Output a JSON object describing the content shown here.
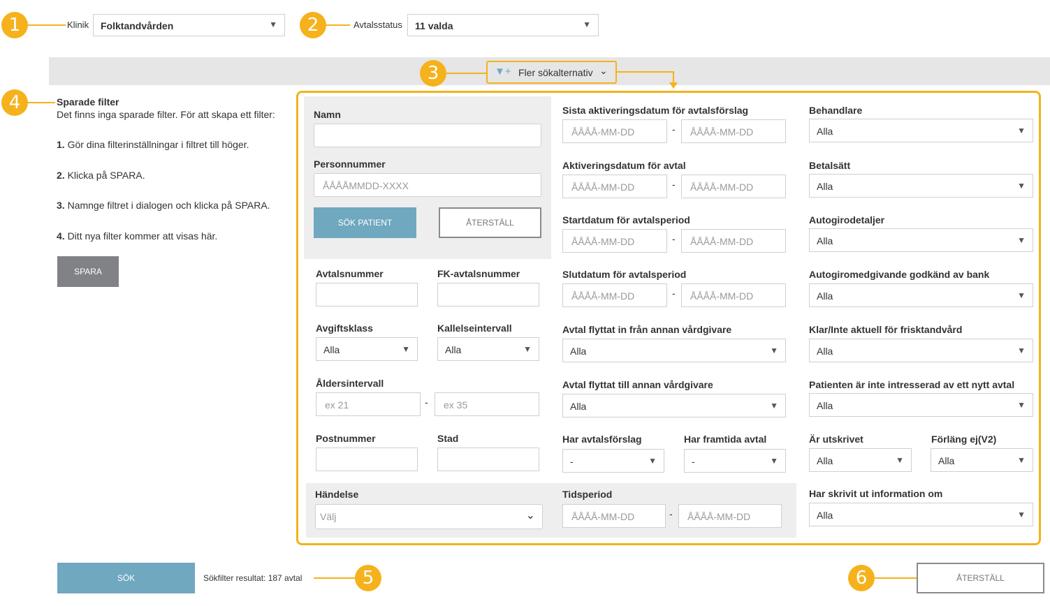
{
  "top": {
    "klinik_label": "Klinik",
    "klinik_value": "Folktandvården",
    "avtalsstatus_label": "Avtalsstatus",
    "avtalsstatus_value": "11 valda"
  },
  "badges": [
    "1",
    "2",
    "3",
    "4",
    "5",
    "6"
  ],
  "more_options": {
    "label": "Fler sökalternativ"
  },
  "saved": {
    "title": "Sparade filter",
    "intro": "Det finns inga sparade filter. För att skapa ett filter:",
    "steps": [
      {
        "num": "1.",
        "text": " Gör dina filterinställningar i filtret till höger."
      },
      {
        "num": "2.",
        "text": " Klicka på SPARA."
      },
      {
        "num": "3.",
        "text": " Namnge filtret i dialogen och klicka på SPARA."
      },
      {
        "num": "4.",
        "text": " Ditt nya filter kommer att visas här."
      }
    ],
    "save_button": "SPARA"
  },
  "patient": {
    "name_label": "Namn",
    "pnr_label": "Personnummer",
    "pnr_placeholder": "ÅÅÅÅMMDD-XXXX",
    "search_button": "SÖK PATIENT",
    "reset_button": "ÅTERSTÄLL"
  },
  "filters": {
    "avtalsnummer": "Avtalsnummer",
    "fk_avtalsnummer": "FK-avtalsnummer",
    "avgiftsklass": "Avgiftsklass",
    "avgiftsklass_value": "Alla",
    "kallelseintervall": "Kallelseintervall",
    "kallelseintervall_value": "Alla",
    "aldersintervall": "Åldersintervall",
    "alder_from_ph": "ex 21",
    "alder_to_ph": "ex 35",
    "postnummer": "Postnummer",
    "stad": "Stad",
    "handelse": "Händelse",
    "handelse_ph": "Välj",
    "tidsperiod": "Tidsperiod"
  },
  "middle": {
    "sista_aktivering": "Sista aktiveringsdatum för avtalsförslag",
    "aktivering_avtal": "Aktiveringsdatum för avtal",
    "startdatum": "Startdatum för avtalsperiod",
    "slutdatum": "Slutdatum för avtalsperiod",
    "flyttat_in": "Avtal flyttat in från annan vårdgivare",
    "flyttat_in_value": "Alla",
    "flyttat_till": "Avtal flyttat till annan vårdgivare",
    "flyttat_till_value": "Alla",
    "har_forslag": "Har avtalsförslag",
    "har_forslag_value": "-",
    "har_framtida": "Har framtida avtal",
    "har_framtida_value": "-",
    "date_ph": "ÅÅÅÅ-MM-DD",
    "dash": "-"
  },
  "right": {
    "behandlare": "Behandlare",
    "betalsatt": "Betalsätt",
    "autogirodetaljer": "Autogirodetaljer",
    "autogiromedgivande": "Autogiromedgivande godkänd av bank",
    "klar": "Klar/Inte aktuell för frisktandvård",
    "intresserad": "Patienten är inte intresserad av ett nytt avtal",
    "utskrivet": "Är utskrivet",
    "forlang": "Förläng ej(V2)",
    "skrivit_ut": "Har skrivit ut information om",
    "alla": "Alla"
  },
  "bottom": {
    "search_button": "SÖK",
    "result_text": "Sökfilter resultat: 187 avtal",
    "reset_button": "ÅTERSTÄLL"
  },
  "colors": {
    "accent": "#F5B21C",
    "primary_button": "#6FA8BF",
    "gray_button": "#808285",
    "panel_gray": "#EEEEEE"
  }
}
